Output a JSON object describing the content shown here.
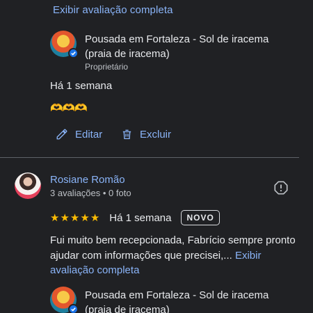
{
  "previous_review": {
    "expand_link": "Exibir avaliação completa"
  },
  "owner_reply_1": {
    "name": "Pousada em Fortaleza - Sol de iracema (praia de iracema)",
    "role": "Proprietário",
    "date": "Há 1 semana",
    "emoji": "🫶🫶🫶"
  },
  "actions": {
    "edit": "Editar",
    "delete": "Excluir"
  },
  "review": {
    "author": "Rosiane Romão",
    "meta": "3 avaliações • 0 foto",
    "rating": 5,
    "date": "Há 1 semana",
    "badge": "NOVO",
    "text": "Fui muito bem recepcionada, Fabrício sempre pronto ajudar com informações que precisei,...",
    "expand_link": "Exibir avaliação completa"
  },
  "owner_reply_2": {
    "name": "Pousada em Fortaleza - Sol de iracema (praia de iracema)"
  },
  "colors": {
    "background": "#202124",
    "link": "#8ab4f8",
    "star": "#fbbc04",
    "verified": "#1a73e8"
  }
}
